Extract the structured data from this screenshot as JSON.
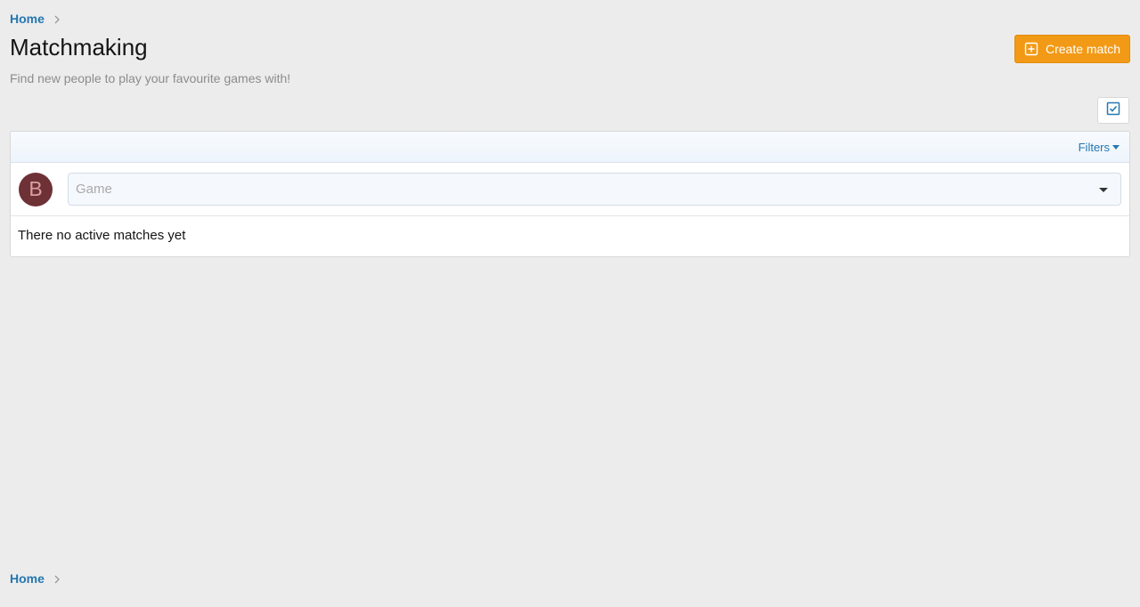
{
  "breadcrumb": {
    "home_label": "Home"
  },
  "page": {
    "title": "Matchmaking",
    "description": "Find new people to play your favourite games with!"
  },
  "actions": {
    "create_match_label": "Create match"
  },
  "filters": {
    "label": "Filters"
  },
  "user": {
    "avatar_letter": "B",
    "avatar_color": "#6e3135"
  },
  "game_select": {
    "placeholder": "Game"
  },
  "matches": {
    "empty_message": "There no active matches yet"
  },
  "colors": {
    "accent": "#2577b1",
    "button": "#f29a16",
    "background": "#ececec"
  }
}
